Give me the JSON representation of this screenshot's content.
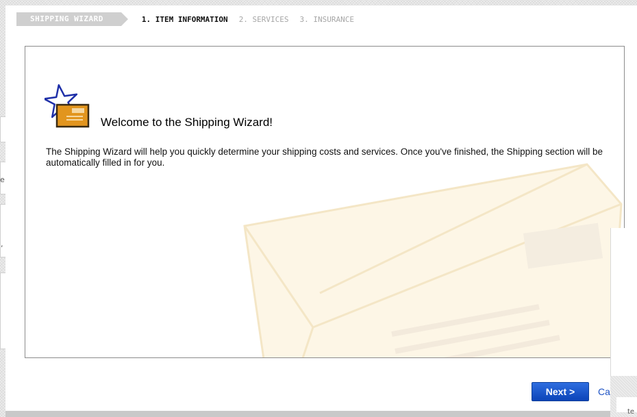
{
  "wizard": {
    "title": "SHIPPING WIZARD",
    "steps": [
      {
        "label": "1. ITEM INFORMATION"
      },
      {
        "label": "2. SERVICES"
      },
      {
        "label": "3. INSURANCE"
      }
    ]
  },
  "welcome": {
    "heading": "Welcome to the Shipping Wizard!",
    "description": "The Shipping Wizard will help you quickly determine your shipping costs and services. Once you've finished, the Shipping section will be automatically filled in for you."
  },
  "actions": {
    "next_label": "Next >",
    "cancel_label": "Ca"
  },
  "background_fragments": {
    "left_char_1": "e",
    "left_char_2": ",",
    "bottom_right_char": "te"
  },
  "colors": {
    "next_button": "#0b44b8",
    "link": "#1d52c4",
    "watermark": "#fdf6e6",
    "wizard_label_bg": "#cfcfcf"
  },
  "icons": {
    "welcome": "star-envelope-icon",
    "watermark": "envelope-watermark"
  }
}
